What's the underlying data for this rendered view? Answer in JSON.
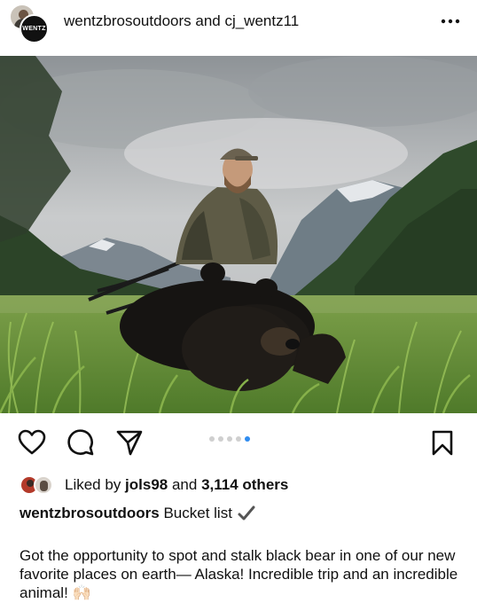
{
  "post": {
    "header_title": "wentzbrosoutdoors and cj_wentz11",
    "avatar_badge_text": "WENTZ",
    "more_icon": "more-horizontal-icon",
    "photo_alt": "photo",
    "carousel": {
      "count": 5,
      "active_index": 4,
      "active_color": "#2f8cf0"
    },
    "likes": {
      "prefix": "Liked by ",
      "user": "jols98",
      "connector": " and ",
      "others": "3,114 others"
    },
    "caption": {
      "username": "wentzbrosoutdoors",
      "text": " Bucket list",
      "emoji": "check-mark-icon"
    },
    "description": "Got the opportunity to spot and stalk black bear in one of our new favorite places on earth— Alaska! Incredible trip and an incredible animal! 🙌🏻"
  },
  "actions": {
    "like_icon": "heart-icon",
    "comment_icon": "comment-icon",
    "share_icon": "send-icon",
    "save_icon": "bookmark-icon"
  }
}
